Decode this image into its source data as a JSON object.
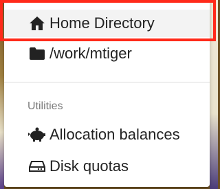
{
  "menu": {
    "home_directory": {
      "label": "Home Directory",
      "icon": "home-icon"
    },
    "work_directory": {
      "label": "/work/mtiger",
      "icon": "folder-icon"
    },
    "section_header": "Utilities",
    "allocation_balances": {
      "label": "Allocation balances",
      "icon": "piggy-bank-icon"
    },
    "disk_quotas": {
      "label": "Disk quotas",
      "icon": "hard-drive-icon"
    }
  },
  "colors": {
    "highlight_border": "#ff2a1a",
    "hover_background": "#f3f3f3",
    "text": "#222222",
    "header_text": "#7a7a7a"
  }
}
